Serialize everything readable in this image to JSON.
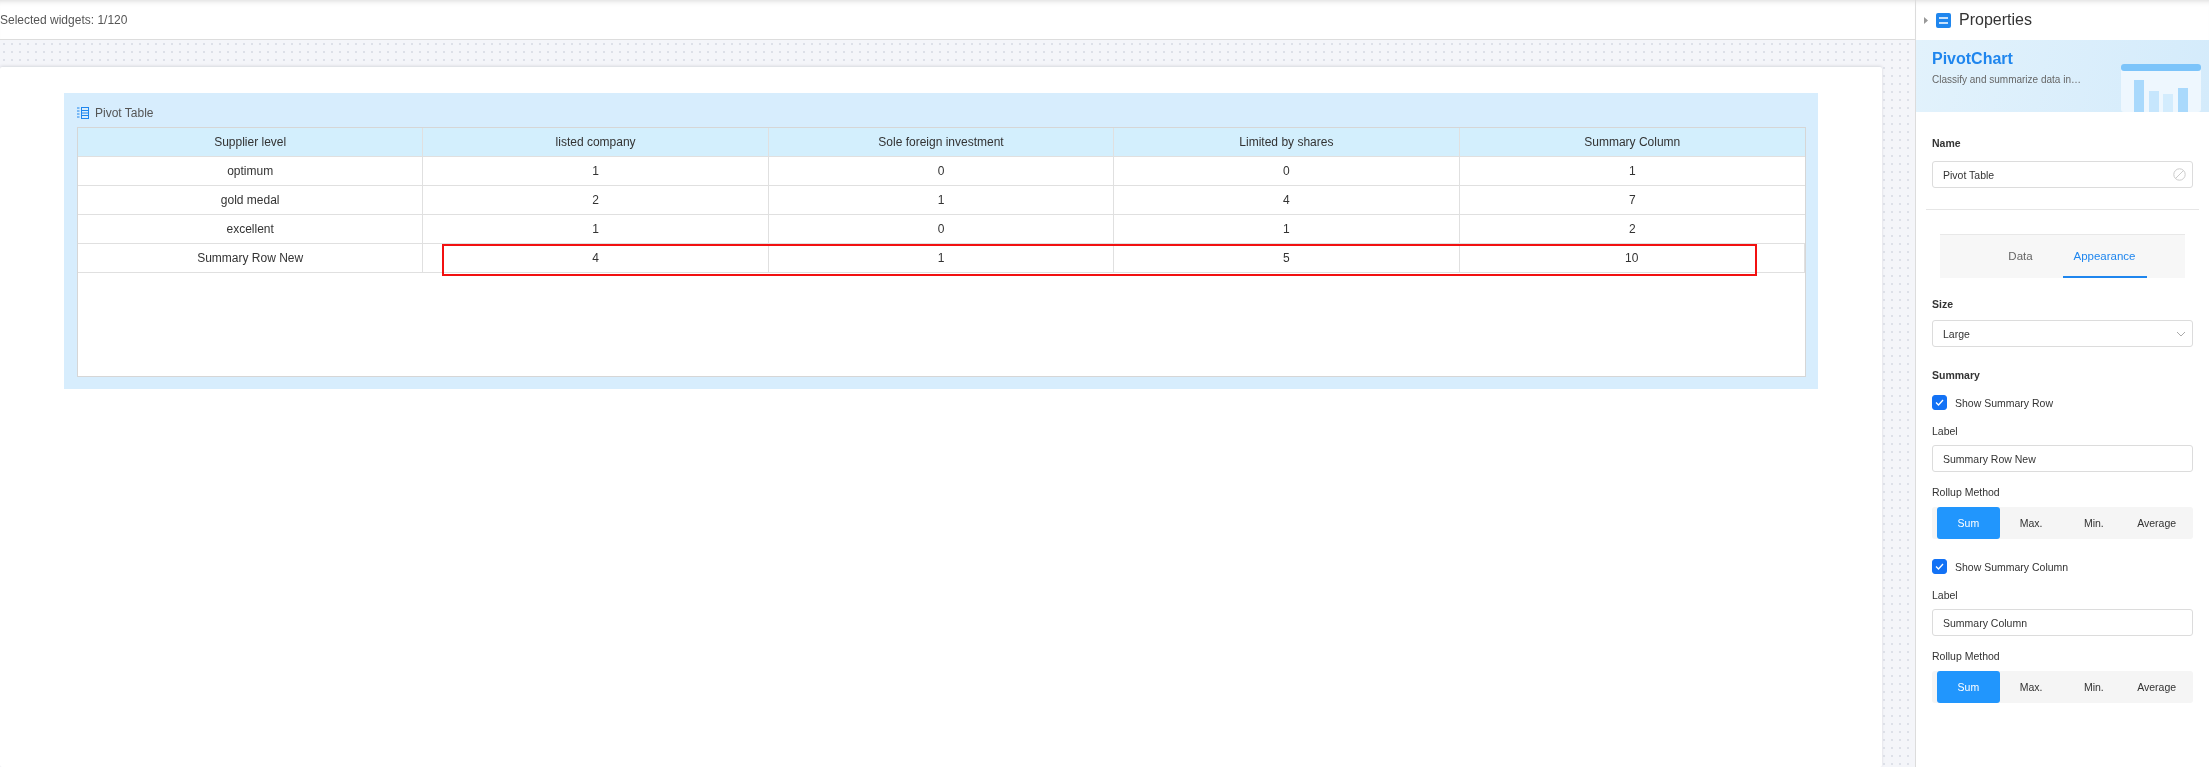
{
  "toolbar": {
    "status": "Selected widgets: 1/120"
  },
  "widget": {
    "title": "Pivot Table",
    "table": {
      "columns": [
        "Supplier level",
        "listed company",
        "Sole foreign investment",
        "Limited by shares",
        "Summary Column"
      ],
      "rows": [
        {
          "cells": [
            "optimum",
            "1",
            "0",
            "0",
            "1"
          ],
          "highlighted": false
        },
        {
          "cells": [
            "gold medal",
            "2",
            "1",
            "4",
            "7"
          ],
          "highlighted": false
        },
        {
          "cells": [
            "excellent",
            "1",
            "0",
            "1",
            "2"
          ],
          "highlighted": false
        },
        {
          "cells": [
            "Summary Row New",
            "4",
            "1",
            "5",
            "10"
          ],
          "highlighted": true
        }
      ]
    }
  },
  "panel": {
    "title": "Properties",
    "banner": {
      "title": "PivotChart",
      "description": "Classify and summarize data in…"
    },
    "name": {
      "label": "Name",
      "value": "Pivot Table"
    },
    "tabs": [
      {
        "label": "Data",
        "selected": false
      },
      {
        "label": "Appearance",
        "selected": true
      }
    ],
    "size": {
      "label": "Size",
      "value": "Large"
    },
    "summary": {
      "heading": "Summary",
      "groups": [
        {
          "checkbox": {
            "label": "Show Summary Row",
            "checked": true
          },
          "field_label": "Label",
          "value": "Summary Row New",
          "method_label": "Rollup Method",
          "methods": [
            {
              "label": "Sum",
              "selected": true
            },
            {
              "label": "Max.",
              "selected": false
            },
            {
              "label": "Min.",
              "selected": false
            },
            {
              "label": "Average",
              "selected": false
            }
          ]
        },
        {
          "checkbox": {
            "label": "Show Summary Column",
            "checked": true
          },
          "field_label": "Label",
          "value": "Summary Column",
          "method_label": "Rollup Method",
          "methods": [
            {
              "label": "Sum",
              "selected": true
            },
            {
              "label": "Max.",
              "selected": false
            },
            {
              "label": "Min.",
              "selected": false
            },
            {
              "label": "Average",
              "selected": false
            }
          ]
        }
      ]
    }
  }
}
